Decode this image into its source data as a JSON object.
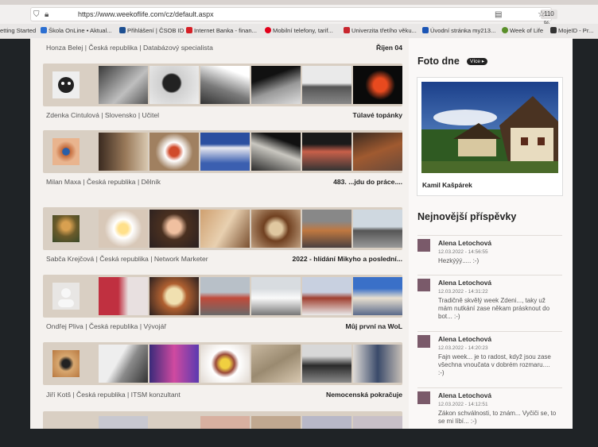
{
  "browser": {
    "url": "https://www.weekoflife.com/cz/default.aspx",
    "zoom": "110 %",
    "bookmarks": [
      "etting Started",
      "Škola OnLine • Aktual...",
      "Přihlášení | ČSOB ID",
      "Internet Banka - finan...",
      "Mobilní telefony, tarif...",
      "Univerzita třetího věku...",
      "Úvodní stránka my213...",
      "Week of Life",
      "MojeID - Pr..."
    ]
  },
  "feed": {
    "rows": [
      {
        "meta": "Honza Belej | Česká republika | Databázový specialista",
        "title": "Říjen 04"
      },
      {
        "meta": "Zdenka Cintulová | Slovensko | Učitel",
        "title": "Túlavé topánky"
      },
      {
        "meta": "Milan Maxa | Česká republika | Dělník",
        "title": "483. ...jdu do práce...."
      },
      {
        "meta": "Sabča Krejčová | Česká republika | Network Marketer",
        "title": "2022 - hlídání Mikyho a poslední..."
      },
      {
        "meta": "Ondřej Pliva | Česká republika | Vývojář",
        "title": "Můj první na WoL"
      },
      {
        "meta": "Jiří Kotš | Česká republika | ITSM konzultant",
        "title": "Nemocenská pokračuje"
      }
    ]
  },
  "sidebar": {
    "photo_heading": "Foto dne",
    "more_label": "Více",
    "photo_author": "Kamil Kašpárek",
    "posts_heading": "Nejnovější příspěvky",
    "posts": [
      {
        "name": "Alena Letochová",
        "date": "12.03.2022 - 14:56:55",
        "text": "Hezkýýý..... :-)"
      },
      {
        "name": "Alena Letochová",
        "date": "12.03.2022 - 14:31:22",
        "text": "Tradičně skvělý week Zdeni..., taky už mám nutkání zase někam prásknout do bot... :-)"
      },
      {
        "name": "Alena Letochová",
        "date": "12.03.2022 - 14:20:23",
        "text": "Fajn week... je to radost, když jsou zase všechna vnoučata v dobrém rozmaru.... :-)"
      },
      {
        "name": "Alena Letochová",
        "date": "12.03.2022 - 14:12:51",
        "text": "Zákon schválnosti, to znám... Vyčiči se, to se mi líbí... :-)"
      }
    ]
  },
  "colors": {
    "strip": "#d9cfc3",
    "page": "#f4f1ee",
    "more_badge": "#222222"
  }
}
